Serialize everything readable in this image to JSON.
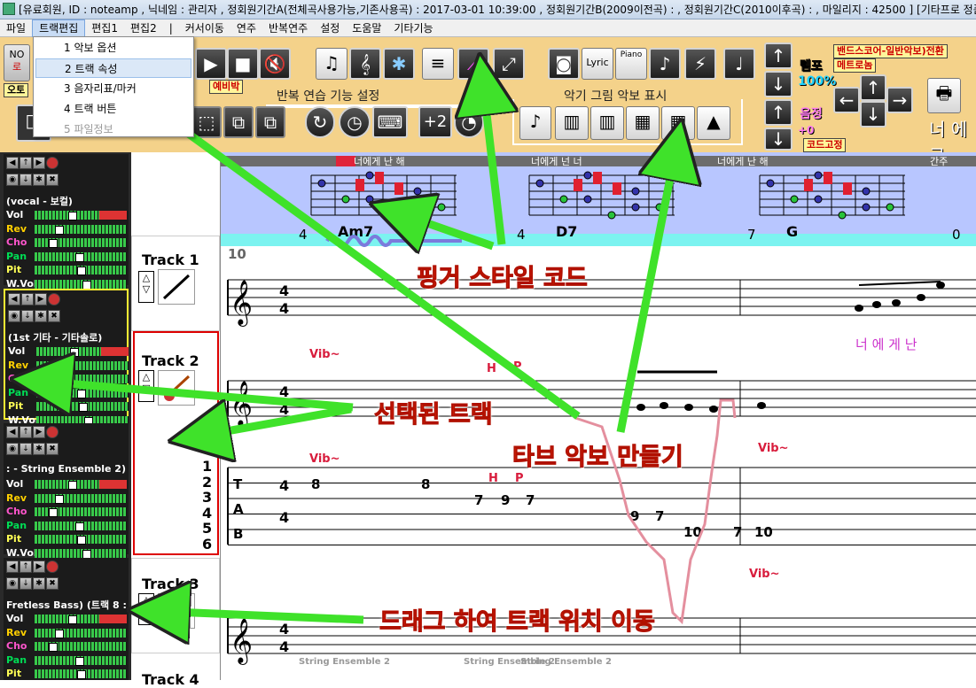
{
  "titlebar": {
    "text": "[유료회원, ID : noteamp , 닉네임 : 관리자 , 정회원기간A(전체곡사용가능,기존사용곡) : 2017-03-01 10:39:00 , 정회원기간B(2009이전곡) : , 정회원기간C(2010이후곡) : , 마일리지 : 42500 ] [기타프로 정품"
  },
  "menu": [
    "파일",
    "트랙편집",
    "편집1",
    "편집2",
    "|",
    "커서이동",
    "연주",
    "반복연주",
    "설정",
    "도움말",
    "기타기능"
  ],
  "dropdown": [
    "1 악보 옵션",
    "2 트랙 속성",
    "3 음자리표/마커",
    "4 트랙 버튼",
    "5 파일정보"
  ],
  "toolbar": {
    "repeat_label": "반복 연습 기능 설정",
    "instrument_label": "악기 그림 악보 표시",
    "lyric": "Lyric",
    "piano": "Piano",
    "tempo_label": "템포",
    "tempo_value": "100%",
    "pitch_label": "음정",
    "pitch_value": "+0",
    "plus2": "+2",
    "band_score": "밴드스코어-일반악보)전환",
    "metronome": "메트로놈",
    "chord_fixed": "코드고정",
    "prep": "예비박",
    "auto": "오토",
    "lyric_right": "너 에 그",
    "no_lab": "NO",
    "ro_lab": "로"
  },
  "tracks": [
    {
      "name": "(vocal - 보컬)",
      "mix": [
        "Vol",
        "Rev",
        "Cho",
        "Pan",
        "Pit",
        "W.Vol"
      ],
      "mix_colors": [
        "#ffffff",
        "#ffd000",
        "#ff55cc",
        "#00dd55",
        "#ffff55",
        "#ffffff"
      ]
    },
    {
      "name": "(1st 기타 - 기타솔로)",
      "mix": [
        "Vol",
        "Rev",
        "Cho",
        "Pan",
        "Pit",
        "W.Vol"
      ],
      "mix_colors": [
        "#ffffff",
        "#ffd000",
        "#ff55cc",
        "#00dd55",
        "#ffff55",
        "#ffffff"
      ]
    },
    {
      "name": ": - String Ensemble 2) (!",
      "mix": [
        "Vol",
        "Rev",
        "Cho",
        "Pan",
        "Pit",
        "W.Vol"
      ],
      "mix_colors": [
        "#ffffff",
        "#ffd000",
        "#ff55cc",
        "#00dd55",
        "#ffff55",
        "#ffffff"
      ]
    },
    {
      "name": "Fretless Bass) (트랙 8 :",
      "mix": [
        "Vol",
        "Rev",
        "Cho",
        "Pan",
        "Pit"
      ],
      "mix_colors": [
        "#ffffff",
        "#ffd000",
        "#ff55cc",
        "#00dd55",
        "#ffff55"
      ]
    }
  ],
  "track_labels": [
    "Track 1",
    "Track 2",
    "Track 3",
    "Track 4"
  ],
  "tab_strings": [
    "1",
    "2",
    "3",
    "4",
    "5",
    "6"
  ],
  "score": {
    "section_labels": [
      "너에게 난 해",
      "너에게 넌 너",
      "너에게 난 해",
      "간주"
    ],
    "chords": [
      {
        "name": "Am7",
        "fret": "4"
      },
      {
        "name": "D7",
        "fret": "4"
      },
      {
        "name": "G",
        "fret": "7"
      },
      {
        "name": "",
        "fret": "0"
      }
    ],
    "measure_number": "10",
    "lyrics": "너  에  게  난",
    "vib": "Vib~",
    "h": "H",
    "p": "P",
    "tab_letters": [
      "T",
      "A",
      "B"
    ],
    "time_sig": "4",
    "tab_numbers": [
      "8",
      "8",
      "7",
      "9",
      "7",
      "9",
      "7",
      "10",
      "7",
      "10"
    ],
    "string_ens": [
      "String Ensemble 2",
      "String Ensemble 2",
      "String Ensemble 2"
    ]
  },
  "annotations": {
    "finger_chord": "핑거 스타일 코드",
    "selected_track": "선택된 트랙",
    "make_tab": "타브 악보 만들기",
    "drag_move": "드래그 하여 트랙 위치 이동"
  }
}
